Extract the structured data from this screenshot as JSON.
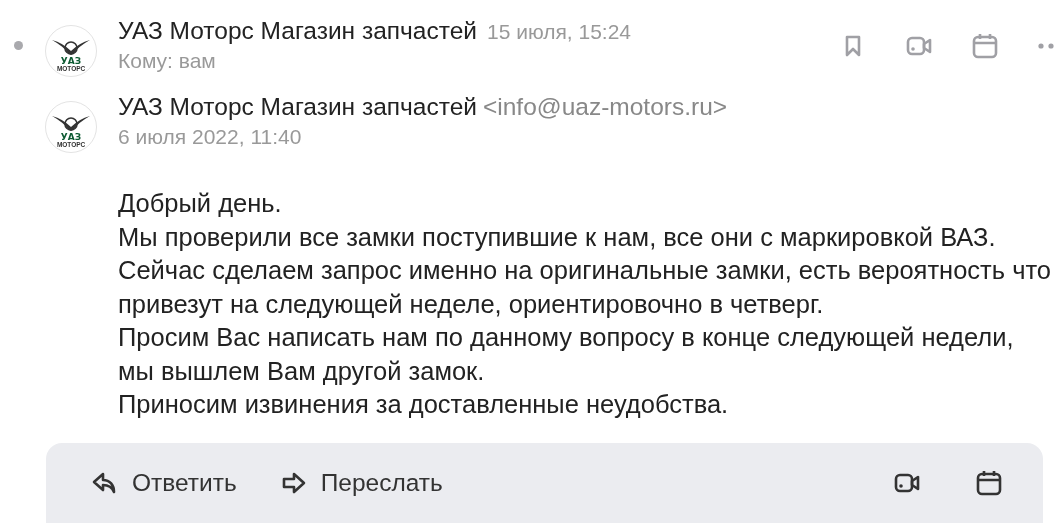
{
  "thread_header": {
    "unread": true,
    "avatar": {
      "title": "УАЗ",
      "subtitle": "МОТОРС"
    },
    "sender": "УАЗ Моторс Магазин запчастей",
    "date": "15 июля, 15:24",
    "recipient": "Кому: вам",
    "actions": [
      {
        "kind": "bookmark"
      },
      {
        "kind": "video"
      },
      {
        "kind": "calendar"
      },
      {
        "kind": "more"
      }
    ]
  },
  "message": {
    "avatar": {
      "title": "УАЗ",
      "subtitle": "МОТОРС"
    },
    "sender": "УАЗ Моторс Магазин запчастей",
    "email": "<info@uaz-motors.ru>",
    "date": "6 июля 2022, 11:40",
    "paragraphs": [
      "Добрый день.",
      "Мы проверили все замки поступившие к нам, все они с маркировкой ВАЗ.",
      "Сейчас сделаем запрос именно на оригинальные замки, есть вероятность что привезут на следующей неделе, ориентировочно в четверг.",
      "Просим Вас написать нам по данному вопросу в конце следующей недели, мы вышлем Вам другой замок.",
      "Приносим извинения за доставленные неудобства."
    ]
  },
  "reply_bar": {
    "buttons": [
      {
        "kind": "reply",
        "label": "Ответить"
      },
      {
        "kind": "forward",
        "label": "Переслать"
      }
    ],
    "actions": [
      {
        "kind": "video"
      },
      {
        "kind": "calendar"
      }
    ]
  }
}
